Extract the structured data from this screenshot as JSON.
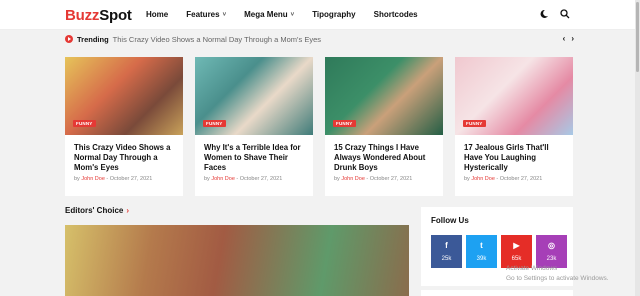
{
  "logo": {
    "part1": "Buzz",
    "part2": "Spot"
  },
  "nav": [
    "Home",
    "Features",
    "Mega Menu",
    "Tipography",
    "Shortcodes"
  ],
  "icons": {
    "theme": "moon-icon",
    "search": "search-icon"
  },
  "ticker": {
    "label": "Trending",
    "text": "This Crazy Video Shows a Normal Day Through a Mom's Eyes",
    "prev": "‹",
    "next": "›"
  },
  "cards": [
    {
      "badge": "FUNNY",
      "title": "This Crazy Video Shows a Normal Day Through a Mom's Eyes",
      "by": "by",
      "author": "John Doe",
      "date": "- October 27, 2021"
    },
    {
      "badge": "FUNNY",
      "title": "Why It's a Terrible Idea for Women to Shave Their Faces",
      "by": "by",
      "author": "John Doe",
      "date": "- October 27, 2021"
    },
    {
      "badge": "FUNNY",
      "title": "15 Crazy Things I Have Always Wondered About Drunk Boys",
      "by": "by",
      "author": "John Doe",
      "date": "- October 27, 2021"
    },
    {
      "badge": "FUNNY",
      "title": "17 Jealous Girls That'll Have You Laughing Hysterically",
      "by": "by",
      "author": "John Doe",
      "date": "- October 27, 2021"
    }
  ],
  "editors_choice": {
    "title": "Editors' Choice",
    "chevron": "›"
  },
  "follow": {
    "title": "Follow Us",
    "items": [
      {
        "icon": "f",
        "count": "25k"
      },
      {
        "icon": "t",
        "count": "39k"
      },
      {
        "icon": "▶",
        "count": "65k"
      },
      {
        "icon": "◎",
        "count": "23k"
      }
    ]
  },
  "watermark": {
    "line1": "Activate Windows",
    "line2": "Go to Settings to activate Windows."
  },
  "colors": {
    "accent": "#e53935",
    "facebook": "#3b5998",
    "twitter": "#1da1f2",
    "youtube": "#e52d27",
    "instagram": "#a63fb7"
  }
}
